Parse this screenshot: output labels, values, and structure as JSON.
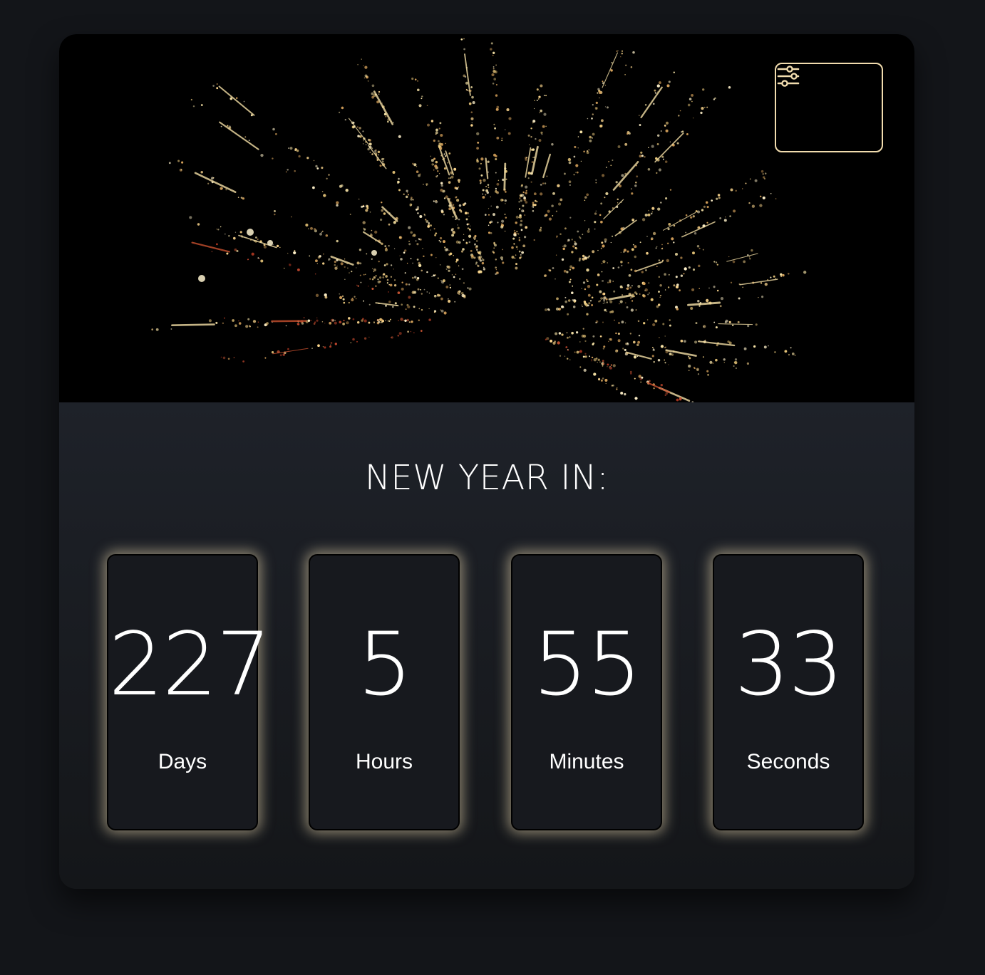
{
  "hero": {
    "image": "fireworks-photo",
    "settings_button": {
      "icon": "sliders-icon",
      "accent_color": "#f1dcae"
    }
  },
  "countdown": {
    "heading": "NEW YEAR IN:",
    "units": [
      {
        "value": "227",
        "label": "Days"
      },
      {
        "value": "5",
        "label": "Hours"
      },
      {
        "value": "55",
        "label": "Minutes"
      },
      {
        "value": "33",
        "label": "Seconds"
      }
    ],
    "glow_color": "#f0deb4"
  }
}
